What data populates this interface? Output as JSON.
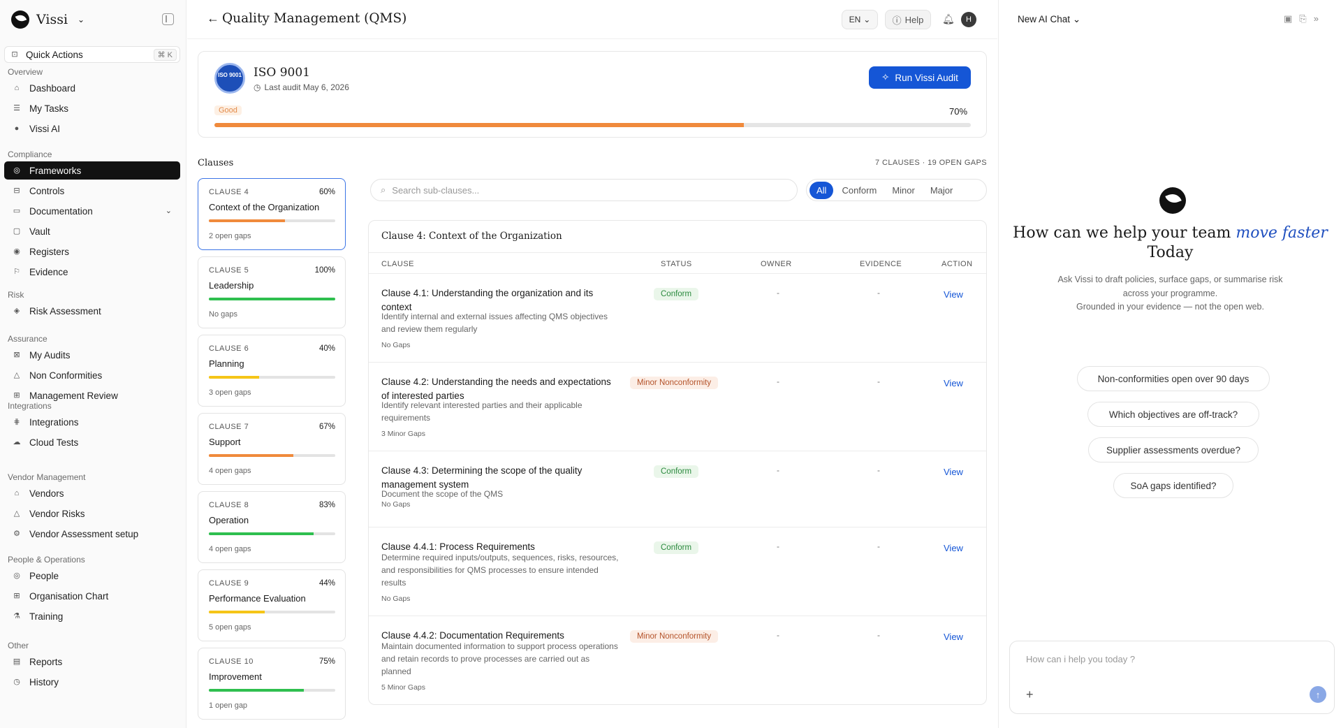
{
  "app": {
    "name": "Vissi"
  },
  "sidebar": {
    "quick_actions": {
      "label": "Quick Actions",
      "shortcut": "⌘ K"
    },
    "sections": [
      {
        "title": "Overview",
        "items": [
          {
            "label": "Dashboard",
            "icon": "home-icon"
          },
          {
            "label": "My Tasks",
            "icon": "tasks-icon"
          },
          {
            "label": "Vissi AI",
            "icon": "vissi-ai-icon"
          }
        ]
      },
      {
        "title": "Compliance",
        "items": [
          {
            "label": "Frameworks",
            "icon": "frameworks-icon",
            "active": true
          },
          {
            "label": "Controls",
            "icon": "controls-icon"
          },
          {
            "label": "Documentation",
            "icon": "documentation-icon",
            "expandable": true
          },
          {
            "label": "Vault",
            "icon": "vault-icon"
          },
          {
            "label": "Registers",
            "icon": "registers-icon"
          },
          {
            "label": "Evidence",
            "icon": "evidence-icon"
          }
        ]
      },
      {
        "title": "Risk",
        "items": [
          {
            "label": "Risk Assessment",
            "icon": "risk-icon"
          }
        ]
      },
      {
        "title": "Assurance",
        "items": [
          {
            "label": "My Audits",
            "icon": "audits-icon"
          },
          {
            "label": "Non Conformities",
            "icon": "nonconformity-icon"
          },
          {
            "label": "Management Review",
            "icon": "review-icon"
          }
        ]
      },
      {
        "title": "Integrations",
        "items": [
          {
            "label": "Integrations",
            "icon": "integrations-icon"
          },
          {
            "label": "Cloud Tests",
            "icon": "cloud-tests-icon"
          }
        ]
      },
      {
        "title": "Vendor Management",
        "items": [
          {
            "label": "Vendors",
            "icon": "vendors-icon"
          },
          {
            "label": "Vendor Risks",
            "icon": "vendor-risks-icon"
          },
          {
            "label": "Vendor Assessment setup",
            "icon": "vendor-setup-icon"
          }
        ]
      },
      {
        "title": "People & Operations",
        "items": [
          {
            "label": "People",
            "icon": "people-icon"
          },
          {
            "label": "Organisation Chart",
            "icon": "org-chart-icon"
          },
          {
            "label": "Training",
            "icon": "training-icon"
          }
        ]
      },
      {
        "title": "Other",
        "items": [
          {
            "label": "Reports",
            "icon": "reports-icon"
          },
          {
            "label": "History",
            "icon": "history-icon"
          }
        ]
      }
    ]
  },
  "header": {
    "title": "Quality Management (QMS)",
    "language": "EN",
    "help_label": "Help",
    "avatar_initial": "H"
  },
  "framework": {
    "seal_text": "ISO 9001",
    "name": "ISO 9001",
    "last_audit": "Last audit May 6, 2026",
    "run_audit_label": "Run Vissi Audit",
    "status": "Good",
    "progress_label": "70%",
    "progress": 0.7,
    "progress_color": "#f08a3c"
  },
  "clauses": {
    "heading": "Clauses",
    "summary": "7 CLAUSES · 19 OPEN GAPS",
    "items": [
      {
        "num": "CLAUSE 4",
        "pct_label": "60%",
        "progress": 0.6,
        "color": "#f08a3c",
        "name": "Context of the Organization",
        "gaps": "2 open gaps",
        "active": true
      },
      {
        "num": "CLAUSE 5",
        "pct_label": "100%",
        "progress": 1.0,
        "color": "#2fbf4f",
        "name": "Leadership",
        "gaps": "No gaps"
      },
      {
        "num": "CLAUSE 6",
        "pct_label": "40%",
        "progress": 0.4,
        "color": "#f5c518",
        "name": "Planning",
        "gaps": "3 open gaps"
      },
      {
        "num": "CLAUSE 7",
        "pct_label": "67%",
        "progress": 0.67,
        "color": "#f08a3c",
        "name": "Support",
        "gaps": "4 open gaps"
      },
      {
        "num": "CLAUSE 8",
        "pct_label": "83%",
        "progress": 0.83,
        "color": "#2fbf4f",
        "name": "Operation",
        "gaps": "4 open gaps"
      },
      {
        "num": "CLAUSE 9",
        "pct_label": "44%",
        "progress": 0.44,
        "color": "#f5c518",
        "name": "Performance Evaluation",
        "gaps": "5 open gaps"
      },
      {
        "num": "CLAUSE 10",
        "pct_label": "75%",
        "progress": 0.75,
        "color": "#2fbf4f",
        "name": "Improvement",
        "gaps": "1 open gap"
      }
    ]
  },
  "search": {
    "placeholder": "Search sub-clauses..."
  },
  "filters": [
    {
      "label": "All",
      "active": true
    },
    {
      "label": "Conform"
    },
    {
      "label": "Minor"
    },
    {
      "label": "Major"
    }
  ],
  "table": {
    "title": "Clause 4: Context of the Organization",
    "columns": {
      "clause": "CLAUSE",
      "status": "STATUS",
      "owner": "OWNER",
      "evidence": "EVIDENCE",
      "action": "ACTION"
    },
    "rows": [
      {
        "title": "Clause 4.1: Understanding the organization and its context",
        "desc": "Identify internal and external issues affecting QMS objectives and review them regularly",
        "gaps": "No Gaps",
        "status": "Conform",
        "status_type": "conform",
        "owner": "-",
        "evidence": "-",
        "action": "View"
      },
      {
        "title": "Clause 4.2: Understanding the needs and expectations of interested parties",
        "desc": "Identify relevant interested parties and their applicable requirements",
        "gaps": "3 Minor Gaps",
        "status": "Minor Nonconformity",
        "status_type": "minor",
        "owner": "-",
        "evidence": "-",
        "action": "View"
      },
      {
        "title": "Clause 4.3: Determining the scope of the quality management system",
        "desc": "Document the scope of the QMS",
        "gaps": "No Gaps",
        "status": "Conform",
        "status_type": "conform",
        "owner": "-",
        "evidence": "-",
        "action": "View"
      },
      {
        "title": "Clause 4.4.1: Process Requirements",
        "desc": "Determine required inputs/outputs, sequences, risks, resources, and responsibilities for QMS processes to ensure intended results",
        "gaps": "No Gaps",
        "status": "Conform",
        "status_type": "conform",
        "owner": "-",
        "evidence": "-",
        "action": "View"
      },
      {
        "title": "Clause 4.4.2: Documentation Requirements",
        "desc": "Maintain documented information to support process operations and retain records to prove processes are carried out as planned",
        "gaps": "5 Minor Gaps",
        "status": "Minor Nonconformity",
        "status_type": "minor",
        "owner": "-",
        "evidence": "-",
        "action": "View"
      }
    ]
  },
  "chat": {
    "title": "New AI Chat",
    "heading_pre": "How can we help your team",
    "heading_em": "move faster",
    "heading_post": "Today",
    "sub_line1": "Ask Vissi to draft policies, surface gaps, or summarise risk",
    "sub_line2": "across your programme.",
    "sub_line3": "Grounded in your evidence — not the open web.",
    "suggestions": [
      "Non-conformities open over 90 days",
      "Which objectives are off-track?",
      "Supplier assessments overdue?",
      "SoA gaps identified?"
    ],
    "input_placeholder": "How can i help you today ?"
  }
}
